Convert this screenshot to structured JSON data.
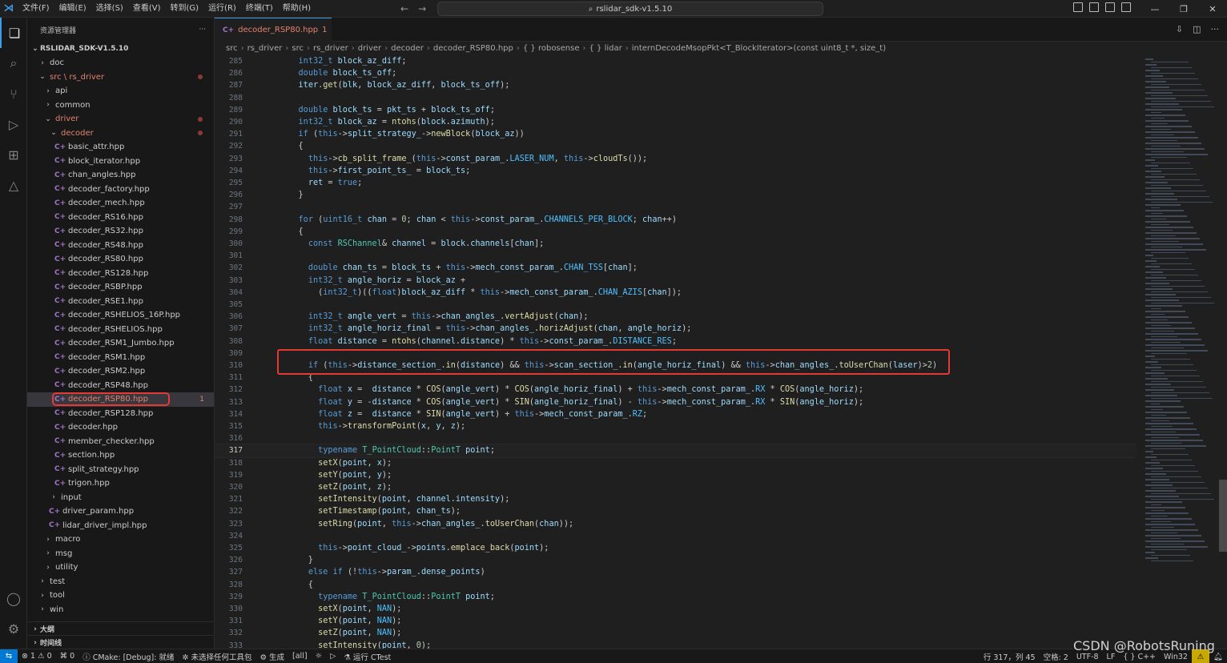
{
  "titlebar": {
    "menus": [
      "文件(F)",
      "编辑(E)",
      "选择(S)",
      "查看(V)",
      "转到(G)",
      "运行(R)",
      "终端(T)",
      "帮助(H)"
    ],
    "search_text": "rslidar_sdk-v1.5.10"
  },
  "sidebar": {
    "title": "资源管理器",
    "root": "RSLIDAR_SDK-V1.5.10",
    "items": [
      {
        "indent": 1,
        "chev": "›",
        "label": "doc"
      },
      {
        "indent": 1,
        "chev": "⌄",
        "label": "src \\ rs_driver",
        "mod": true,
        "dot": true
      },
      {
        "indent": 2,
        "chev": "›",
        "label": "api"
      },
      {
        "indent": 2,
        "chev": "›",
        "label": "common"
      },
      {
        "indent": 2,
        "chev": "⌄",
        "label": "driver",
        "mod": true,
        "dot": true
      },
      {
        "indent": 3,
        "chev": "⌄",
        "label": "decoder",
        "mod": true,
        "dot": true
      },
      {
        "indent": 4,
        "icon": "C+",
        "label": "basic_attr.hpp"
      },
      {
        "indent": 4,
        "icon": "C+",
        "label": "block_iterator.hpp"
      },
      {
        "indent": 4,
        "icon": "C+",
        "label": "chan_angles.hpp"
      },
      {
        "indent": 4,
        "icon": "C+",
        "label": "decoder_factory.hpp"
      },
      {
        "indent": 4,
        "icon": "C+",
        "label": "decoder_mech.hpp"
      },
      {
        "indent": 4,
        "icon": "C+",
        "label": "decoder_RS16.hpp"
      },
      {
        "indent": 4,
        "icon": "C+",
        "label": "decoder_RS32.hpp"
      },
      {
        "indent": 4,
        "icon": "C+",
        "label": "decoder_RS48.hpp"
      },
      {
        "indent": 4,
        "icon": "C+",
        "label": "decoder_RS80.hpp"
      },
      {
        "indent": 4,
        "icon": "C+",
        "label": "decoder_RS128.hpp"
      },
      {
        "indent": 4,
        "icon": "C+",
        "label": "decoder_RSBP.hpp"
      },
      {
        "indent": 4,
        "icon": "C+",
        "label": "decoder_RSE1.hpp"
      },
      {
        "indent": 4,
        "icon": "C+",
        "label": "decoder_RSHELIOS_16P.hpp"
      },
      {
        "indent": 4,
        "icon": "C+",
        "label": "decoder_RSHELIOS.hpp"
      },
      {
        "indent": 4,
        "icon": "C+",
        "label": "decoder_RSM1_Jumbo.hpp"
      },
      {
        "indent": 4,
        "icon": "C+",
        "label": "decoder_RSM1.hpp"
      },
      {
        "indent": 4,
        "icon": "C+",
        "label": "decoder_RSM2.hpp"
      },
      {
        "indent": 4,
        "icon": "C+",
        "label": "decoder_RSP48.hpp"
      },
      {
        "indent": 4,
        "icon": "C+",
        "label": "decoder_RSP80.hpp",
        "mod": true,
        "selected": true,
        "count": "1"
      },
      {
        "indent": 4,
        "icon": "C+",
        "label": "decoder_RSP128.hpp"
      },
      {
        "indent": 4,
        "icon": "C+",
        "label": "decoder.hpp"
      },
      {
        "indent": 4,
        "icon": "C+",
        "label": "member_checker.hpp"
      },
      {
        "indent": 4,
        "icon": "C+",
        "label": "section.hpp"
      },
      {
        "indent": 4,
        "icon": "C+",
        "label": "split_strategy.hpp"
      },
      {
        "indent": 4,
        "icon": "C+",
        "label": "trigon.hpp"
      },
      {
        "indent": 3,
        "chev": "›",
        "label": "input"
      },
      {
        "indent": 3,
        "icon": "C+",
        "label": "driver_param.hpp"
      },
      {
        "indent": 3,
        "icon": "C+",
        "label": "lidar_driver_impl.hpp"
      },
      {
        "indent": 2,
        "chev": "›",
        "label": "macro"
      },
      {
        "indent": 2,
        "chev": "›",
        "label": "msg"
      },
      {
        "indent": 2,
        "chev": "›",
        "label": "utility"
      },
      {
        "indent": 1,
        "chev": "›",
        "label": "test"
      },
      {
        "indent": 1,
        "chev": "›",
        "label": "tool"
      },
      {
        "indent": 1,
        "chev": "›",
        "label": "win"
      }
    ],
    "outline_label": "大纲",
    "timeline_label": "时间线"
  },
  "editor": {
    "tab_label": "decoder_RSP80.hpp",
    "tab_count": "1",
    "breadcrumb": [
      "src",
      "rs_driver",
      "src",
      "rs_driver",
      "driver",
      "decoder",
      "decoder_RSP80.hpp",
      "{ } robosense",
      "{ } lidar",
      "internDecodeMsopPkt<T_BlockIterator>(const uint8_t *, size_t)"
    ],
    "current_line": 317,
    "lines": [
      {
        "n": 285,
        "t": "    int32_t block_az_diff;"
      },
      {
        "n": 286,
        "t": "    double block_ts_off;"
      },
      {
        "n": 287,
        "t": "    iter.get(blk, block_az_diff, block_ts_off);"
      },
      {
        "n": 288,
        "t": ""
      },
      {
        "n": 289,
        "t": "    double block_ts = pkt_ts + block_ts_off;"
      },
      {
        "n": 290,
        "t": "    int32_t block_az = ntohs(block.azimuth);"
      },
      {
        "n": 291,
        "t": "    if (this->split_strategy_->newBlock(block_az))"
      },
      {
        "n": 292,
        "t": "    {"
      },
      {
        "n": 293,
        "t": "      this->cb_split_frame_(this->const_param_.LASER_NUM, this->cloudTs());"
      },
      {
        "n": 294,
        "t": "      this->first_point_ts_ = block_ts;"
      },
      {
        "n": 295,
        "t": "      ret = true;"
      },
      {
        "n": 296,
        "t": "    }"
      },
      {
        "n": 297,
        "t": ""
      },
      {
        "n": 298,
        "t": "    for (uint16_t chan = 0; chan < this->const_param_.CHANNELS_PER_BLOCK; chan++)"
      },
      {
        "n": 299,
        "t": "    {"
      },
      {
        "n": 300,
        "t": "      const RSChannel& channel = block.channels[chan];"
      },
      {
        "n": 301,
        "t": ""
      },
      {
        "n": 302,
        "t": "      double chan_ts = block_ts + this->mech_const_param_.CHAN_TSS[chan];"
      },
      {
        "n": 303,
        "t": "      int32_t angle_horiz = block_az +"
      },
      {
        "n": 304,
        "t": "        (int32_t)((float)block_az_diff * this->mech_const_param_.CHAN_AZIS[chan]);"
      },
      {
        "n": 305,
        "t": ""
      },
      {
        "n": 306,
        "t": "      int32_t angle_vert = this->chan_angles_.vertAdjust(chan);"
      },
      {
        "n": 307,
        "t": "      int32_t angle_horiz_final = this->chan_angles_.horizAdjust(chan, angle_horiz);"
      },
      {
        "n": 308,
        "t": "      float distance = ntohs(channel.distance) * this->const_param_.DISTANCE_RES;"
      },
      {
        "n": 309,
        "t": ""
      },
      {
        "n": 310,
        "t": "      if (this->distance_section_.in(distance) && this->scan_section_.in(angle_horiz_final) && this->chan_angles_.toUserChan(laser)>2)"
      },
      {
        "n": 311,
        "t": "      {"
      },
      {
        "n": 312,
        "t": "        float x =  distance * COS(angle_vert) * COS(angle_horiz_final) + this->mech_const_param_.RX * COS(angle_horiz);"
      },
      {
        "n": 313,
        "t": "        float y = -distance * COS(angle_vert) * SIN(angle_horiz_final) - this->mech_const_param_.RX * SIN(angle_horiz);"
      },
      {
        "n": 314,
        "t": "        float z =  distance * SIN(angle_vert) + this->mech_const_param_.RZ;"
      },
      {
        "n": 315,
        "t": "        this->transformPoint(x, y, z);"
      },
      {
        "n": 316,
        "t": ""
      },
      {
        "n": 317,
        "t": "        typename T_PointCloud::PointT point;"
      },
      {
        "n": 318,
        "t": "        setX(point, x);"
      },
      {
        "n": 319,
        "t": "        setY(point, y);"
      },
      {
        "n": 320,
        "t": "        setZ(point, z);"
      },
      {
        "n": 321,
        "t": "        setIntensity(point, channel.intensity);"
      },
      {
        "n": 322,
        "t": "        setTimestamp(point, chan_ts);"
      },
      {
        "n": 323,
        "t": "        setRing(point, this->chan_angles_.toUserChan(chan));"
      },
      {
        "n": 324,
        "t": ""
      },
      {
        "n": 325,
        "t": "        this->point_cloud_->points.emplace_back(point);"
      },
      {
        "n": 326,
        "t": "      }"
      },
      {
        "n": 327,
        "t": "      else if (!this->param_.dense_points)"
      },
      {
        "n": 328,
        "t": "      {"
      },
      {
        "n": 329,
        "t": "        typename T_PointCloud::PointT point;"
      },
      {
        "n": 330,
        "t": "        setX(point, NAN);"
      },
      {
        "n": 331,
        "t": "        setY(point, NAN);"
      },
      {
        "n": 332,
        "t": "        setZ(point, NAN);"
      },
      {
        "n": 333,
        "t": "        setIntensity(point, 0);"
      }
    ]
  },
  "statusbar": {
    "errors": "⊗ 1 ⚠ 0",
    "ports": "⌘ 0",
    "cmake": "ⓘ CMake: [Debug]: 就绪",
    "kit": "✲ 未选择任何工具包",
    "build": "⚙ 生成",
    "target": "[all]",
    "run": "运行 CTest",
    "position": "行 317，列 45",
    "spaces": "空格: 2",
    "encoding": "UTF-8",
    "eol": "LF",
    "language": "{ } C++",
    "platform": "Win32"
  },
  "watermark": "CSDN @RobotsRuning",
  "colors": {
    "accent": "#3c9ee8",
    "highlight_box": "#e53935",
    "modified": "#e2836f"
  }
}
